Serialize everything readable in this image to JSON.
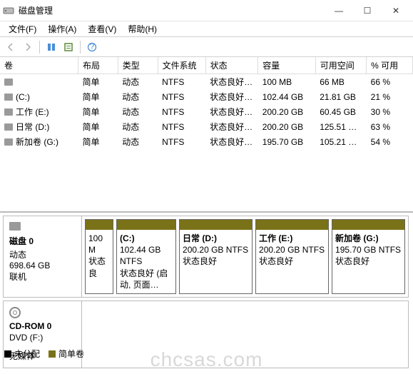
{
  "window": {
    "title": "磁盘管理"
  },
  "winbtns": {
    "min": "—",
    "max": "☐",
    "close": "✕"
  },
  "menu": {
    "file": "文件(F)",
    "action": "操作(A)",
    "view": "查看(V)",
    "help": "帮助(H)"
  },
  "columns": [
    "卷",
    "布局",
    "类型",
    "文件系统",
    "状态",
    "容量",
    "可用空间",
    "% 可用"
  ],
  "volumes": [
    {
      "name": "",
      "layout": "简单",
      "type": "动态",
      "fs": "NTFS",
      "status": "状态良好 (…",
      "capacity": "100 MB",
      "free": "66 MB",
      "pct": "66 %"
    },
    {
      "name": "(C:)",
      "layout": "简单",
      "type": "动态",
      "fs": "NTFS",
      "status": "状态良好 (…",
      "capacity": "102.44 GB",
      "free": "21.81 GB",
      "pct": "21 %"
    },
    {
      "name": "工作 (E:)",
      "layout": "简单",
      "type": "动态",
      "fs": "NTFS",
      "status": "状态良好 (…",
      "capacity": "200.20 GB",
      "free": "60.45 GB",
      "pct": "30 %"
    },
    {
      "name": "日常 (D:)",
      "layout": "简单",
      "type": "动态",
      "fs": "NTFS",
      "status": "状态良好 (…",
      "capacity": "200.20 GB",
      "free": "125.51 …",
      "pct": "63 %"
    },
    {
      "name": "新加卷 (G:)",
      "layout": "简单",
      "type": "动态",
      "fs": "NTFS",
      "status": "状态良好 (…",
      "capacity": "195.70 GB",
      "free": "105.21 …",
      "pct": "54 %"
    }
  ],
  "disk0": {
    "label": "磁盘 0",
    "type": "动态",
    "size": "698.64 GB",
    "status": "联机",
    "parts": [
      {
        "title": "",
        "line1": "100 M",
        "line2": "状态良"
      },
      {
        "title": "(C:)",
        "line1": "102.44 GB NTFS",
        "line2": "状态良好 (启动, 页面…"
      },
      {
        "title": "日常  (D:)",
        "line1": "200.20 GB NTFS",
        "line2": "状态良好"
      },
      {
        "title": "工作  (E:)",
        "line1": "200.20 GB NTFS",
        "line2": "状态良好"
      },
      {
        "title": "新加卷  (G:)",
        "line1": "195.70 GB NTFS",
        "line2": "状态良好"
      }
    ]
  },
  "cdrom": {
    "label": "CD-ROM 0",
    "sub": "DVD (F:)",
    "status": "无媒体"
  },
  "legend": {
    "unalloc": "未分配",
    "simple": "简单卷"
  },
  "watermark": "chcsas.com"
}
